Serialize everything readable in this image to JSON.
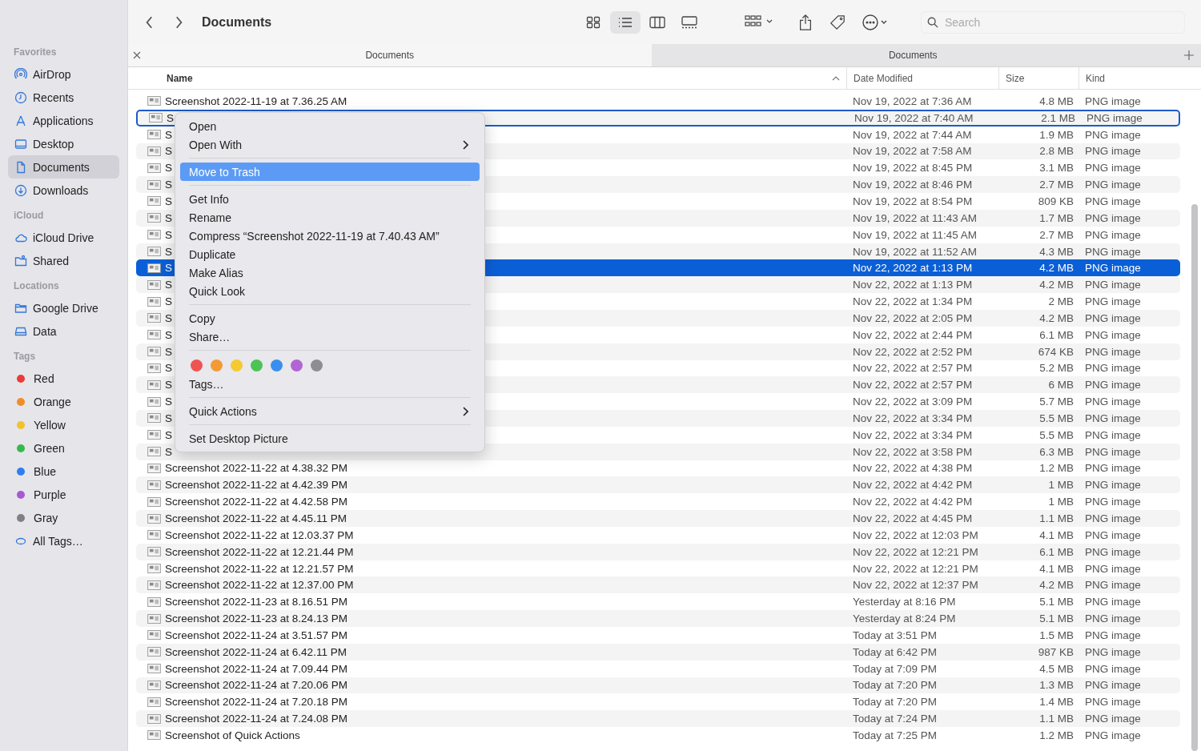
{
  "sidebar": {
    "sections": [
      {
        "title": "Favorites",
        "items": [
          {
            "label": "AirDrop",
            "kind": "airdrop",
            "selected": false
          },
          {
            "label": "Recents",
            "kind": "clock",
            "selected": false
          },
          {
            "label": "Applications",
            "kind": "apps",
            "selected": false
          },
          {
            "label": "Desktop",
            "kind": "desktop",
            "selected": false
          },
          {
            "label": "Documents",
            "kind": "doc",
            "selected": true
          },
          {
            "label": "Downloads",
            "kind": "download",
            "selected": false
          }
        ]
      },
      {
        "title": "iCloud",
        "items": [
          {
            "label": "iCloud Drive",
            "kind": "cloud",
            "selected": false
          },
          {
            "label": "Shared",
            "kind": "shared",
            "selected": false
          }
        ]
      },
      {
        "title": "Locations",
        "items": [
          {
            "label": "Google Drive",
            "kind": "folder",
            "selected": false
          },
          {
            "label": "Data",
            "kind": "disk",
            "selected": false
          }
        ]
      },
      {
        "title": "Tags",
        "items": [
          {
            "label": "Red",
            "kind": "tag",
            "color": "#ea3b36",
            "selected": false
          },
          {
            "label": "Orange",
            "kind": "tag",
            "color": "#f08d2a",
            "selected": false
          },
          {
            "label": "Yellow",
            "kind": "tag",
            "color": "#f2c22a",
            "selected": false
          },
          {
            "label": "Green",
            "kind": "tag",
            "color": "#34b94a",
            "selected": false
          },
          {
            "label": "Blue",
            "kind": "tag",
            "color": "#2d7ff0",
            "selected": false
          },
          {
            "label": "Purple",
            "kind": "tag",
            "color": "#a859d2",
            "selected": false
          },
          {
            "label": "Gray",
            "kind": "tag",
            "color": "#808085",
            "selected": false
          },
          {
            "label": "All Tags…",
            "kind": "alltags",
            "selected": false
          }
        ]
      }
    ]
  },
  "toolbar": {
    "title": "Documents",
    "views": [
      {
        "kind": "icons",
        "selected": false
      },
      {
        "kind": "list",
        "selected": true
      },
      {
        "kind": "columns",
        "selected": false
      },
      {
        "kind": "gallery",
        "selected": false
      }
    ],
    "search": {
      "placeholder": "Search"
    }
  },
  "tabs": [
    {
      "label": "Documents",
      "selected": true
    },
    {
      "label": "Documents",
      "selected": false
    }
  ],
  "columns": [
    {
      "label": "Name",
      "sorted": true
    },
    {
      "label": "Date Modified",
      "sorted": false
    },
    {
      "label": "Size",
      "sorted": false
    },
    {
      "label": "Kind",
      "sorted": false
    }
  ],
  "rows": [
    {
      "name": "Screenshot 2022-11-19 at 7.36.25 AM",
      "date": "Nov 19, 2022 at 7:36 AM",
      "size": "4.8 MB",
      "kind": "PNG image",
      "selected": false,
      "targeted": false
    },
    {
      "name": "S",
      "date": "Nov 19, 2022 at 7:40 AM",
      "size": "2.1 MB",
      "kind": "PNG image",
      "selected": false,
      "targeted": true
    },
    {
      "name": "S",
      "date": "Nov 19, 2022 at 7:44 AM",
      "size": "1.9 MB",
      "kind": "PNG image",
      "selected": false,
      "targeted": false
    },
    {
      "name": "S",
      "date": "Nov 19, 2022 at 7:58 AM",
      "size": "2.8 MB",
      "kind": "PNG image",
      "selected": false,
      "targeted": false
    },
    {
      "name": "S",
      "date": "Nov 19, 2022 at 8:45 PM",
      "size": "3.1 MB",
      "kind": "PNG image",
      "selected": false,
      "targeted": false
    },
    {
      "name": "S",
      "date": "Nov 19, 2022 at 8:46 PM",
      "size": "2.7 MB",
      "kind": "PNG image",
      "selected": false,
      "targeted": false
    },
    {
      "name": "S",
      "date": "Nov 19, 2022 at 8:54 PM",
      "size": "809 KB",
      "kind": "PNG image",
      "selected": false,
      "targeted": false
    },
    {
      "name": "S",
      "date": "Nov 19, 2022 at 11:43 AM",
      "size": "1.7 MB",
      "kind": "PNG image",
      "selected": false,
      "targeted": false
    },
    {
      "name": "S",
      "date": "Nov 19, 2022 at 11:45 AM",
      "size": "2.7 MB",
      "kind": "PNG image",
      "selected": false,
      "targeted": false
    },
    {
      "name": "S",
      "date": "Nov 19, 2022 at 11:52 AM",
      "size": "4.3 MB",
      "kind": "PNG image",
      "selected": false,
      "targeted": false
    },
    {
      "name": "S",
      "date": "Nov 22, 2022 at 1:13 PM",
      "size": "4.2 MB",
      "kind": "PNG image",
      "selected": true,
      "targeted": false
    },
    {
      "name": "S",
      "date": "Nov 22, 2022 at 1:13 PM",
      "size": "4.2 MB",
      "kind": "PNG image",
      "selected": false,
      "targeted": false
    },
    {
      "name": "S",
      "date": "Nov 22, 2022 at 1:34 PM",
      "size": "2 MB",
      "kind": "PNG image",
      "selected": false,
      "targeted": false
    },
    {
      "name": "S",
      "date": "Nov 22, 2022 at 2:05 PM",
      "size": "4.2 MB",
      "kind": "PNG image",
      "selected": false,
      "targeted": false
    },
    {
      "name": "S",
      "date": "Nov 22, 2022 at 2:44 PM",
      "size": "6.1 MB",
      "kind": "PNG image",
      "selected": false,
      "targeted": false
    },
    {
      "name": "S",
      "date": "Nov 22, 2022 at 2:52 PM",
      "size": "674 KB",
      "kind": "PNG image",
      "selected": false,
      "targeted": false
    },
    {
      "name": "S",
      "date": "Nov 22, 2022 at 2:57 PM",
      "size": "5.2 MB",
      "kind": "PNG image",
      "selected": false,
      "targeted": false
    },
    {
      "name": "S",
      "date": "Nov 22, 2022 at 2:57 PM",
      "size": "6 MB",
      "kind": "PNG image",
      "selected": false,
      "targeted": false
    },
    {
      "name": "S",
      "date": "Nov 22, 2022 at 3:09 PM",
      "size": "5.7 MB",
      "kind": "PNG image",
      "selected": false,
      "targeted": false
    },
    {
      "name": "S",
      "date": "Nov 22, 2022 at 3:34 PM",
      "size": "5.5 MB",
      "kind": "PNG image",
      "selected": false,
      "targeted": false
    },
    {
      "name": "S",
      "date": "Nov 22, 2022 at 3:34 PM",
      "size": "5.5 MB",
      "kind": "PNG image",
      "selected": false,
      "targeted": false
    },
    {
      "name": "S",
      "date": "Nov 22, 2022 at 3:58 PM",
      "size": "6.3 MB",
      "kind": "PNG image",
      "selected": false,
      "targeted": false
    },
    {
      "name": "Screenshot 2022-11-22 at 4.38.32 PM",
      "date": "Nov 22, 2022 at 4:38 PM",
      "size": "1.2 MB",
      "kind": "PNG image",
      "selected": false,
      "targeted": false
    },
    {
      "name": "Screenshot 2022-11-22 at 4.42.39 PM",
      "date": "Nov 22, 2022 at 4:42 PM",
      "size": "1 MB",
      "kind": "PNG image",
      "selected": false,
      "targeted": false
    },
    {
      "name": "Screenshot 2022-11-22 at 4.42.58 PM",
      "date": "Nov 22, 2022 at 4:42 PM",
      "size": "1 MB",
      "kind": "PNG image",
      "selected": false,
      "targeted": false
    },
    {
      "name": "Screenshot 2022-11-22 at 4.45.11 PM",
      "date": "Nov 22, 2022 at 4:45 PM",
      "size": "1.1 MB",
      "kind": "PNG image",
      "selected": false,
      "targeted": false
    },
    {
      "name": "Screenshot 2022-11-22 at 12.03.37 PM",
      "date": "Nov 22, 2022 at 12:03 PM",
      "size": "4.1 MB",
      "kind": "PNG image",
      "selected": false,
      "targeted": false
    },
    {
      "name": "Screenshot 2022-11-22 at 12.21.44 PM",
      "date": "Nov 22, 2022 at 12:21 PM",
      "size": "6.1 MB",
      "kind": "PNG image",
      "selected": false,
      "targeted": false
    },
    {
      "name": "Screenshot 2022-11-22 at 12.21.57 PM",
      "date": "Nov 22, 2022 at 12:21 PM",
      "size": "4.1 MB",
      "kind": "PNG image",
      "selected": false,
      "targeted": false
    },
    {
      "name": "Screenshot 2022-11-22 at 12.37.00 PM",
      "date": "Nov 22, 2022 at 12:37 PM",
      "size": "4.2 MB",
      "kind": "PNG image",
      "selected": false,
      "targeted": false
    },
    {
      "name": "Screenshot 2022-11-23 at 8.16.51 PM",
      "date": "Yesterday at 8:16 PM",
      "size": "5.1 MB",
      "kind": "PNG image",
      "selected": false,
      "targeted": false
    },
    {
      "name": "Screenshot 2022-11-23 at 8.24.13 PM",
      "date": "Yesterday at 8:24 PM",
      "size": "5.1 MB",
      "kind": "PNG image",
      "selected": false,
      "targeted": false
    },
    {
      "name": "Screenshot 2022-11-24 at 3.51.57 PM",
      "date": "Today at 3:51 PM",
      "size": "1.5 MB",
      "kind": "PNG image",
      "selected": false,
      "targeted": false
    },
    {
      "name": "Screenshot 2022-11-24 at 6.42.11 PM",
      "date": "Today at 6:42 PM",
      "size": "987 KB",
      "kind": "PNG image",
      "selected": false,
      "targeted": false
    },
    {
      "name": "Screenshot 2022-11-24 at 7.09.44 PM",
      "date": "Today at 7:09 PM",
      "size": "4.5 MB",
      "kind": "PNG image",
      "selected": false,
      "targeted": false
    },
    {
      "name": "Screenshot 2022-11-24 at 7.20.06 PM",
      "date": "Today at 7:20 PM",
      "size": "1.3 MB",
      "kind": "PNG image",
      "selected": false,
      "targeted": false
    },
    {
      "name": "Screenshot 2022-11-24 at 7.20.18 PM",
      "date": "Today at 7:20 PM",
      "size": "1.4 MB",
      "kind": "PNG image",
      "selected": false,
      "targeted": false
    },
    {
      "name": "Screenshot 2022-11-24 at 7.24.08 PM",
      "date": "Today at 7:24 PM",
      "size": "1.1 MB",
      "kind": "PNG image",
      "selected": false,
      "targeted": false
    },
    {
      "name": "Screenshot of Quick Actions",
      "date": "Today at 7:25 PM",
      "size": "1.2 MB",
      "kind": "PNG image",
      "selected": false,
      "targeted": false
    }
  ],
  "menu": {
    "items": [
      {
        "kind": "item",
        "label": "Open",
        "submenu": false,
        "highlighted": false
      },
      {
        "kind": "item",
        "label": "Open With",
        "submenu": true,
        "highlighted": false
      },
      {
        "kind": "separator"
      },
      {
        "kind": "item",
        "label": "Move to Trash",
        "submenu": false,
        "highlighted": true
      },
      {
        "kind": "separator"
      },
      {
        "kind": "item",
        "label": "Get Info",
        "submenu": false,
        "highlighted": false
      },
      {
        "kind": "item",
        "label": "Rename",
        "submenu": false,
        "highlighted": false
      },
      {
        "kind": "item",
        "label": "Compress “Screenshot 2022-11-19 at 7.40.43 AM”",
        "submenu": false,
        "highlighted": false
      },
      {
        "kind": "item",
        "label": "Duplicate",
        "submenu": false,
        "highlighted": false
      },
      {
        "kind": "item",
        "label": "Make Alias",
        "submenu": false,
        "highlighted": false
      },
      {
        "kind": "item",
        "label": "Quick Look",
        "submenu": false,
        "highlighted": false
      },
      {
        "kind": "separator"
      },
      {
        "kind": "item",
        "label": "Copy",
        "submenu": false,
        "highlighted": false
      },
      {
        "kind": "item",
        "label": "Share…",
        "submenu": false,
        "highlighted": false
      },
      {
        "kind": "separator"
      },
      {
        "kind": "colors",
        "colors": [
          {
            "color": "#ee5452"
          },
          {
            "color": "#f39a34"
          },
          {
            "color": "#f5c930"
          },
          {
            "color": "#4cc355"
          },
          {
            "color": "#3a8ef0"
          },
          {
            "color": "#b264d5"
          },
          {
            "color": "#8e8e92"
          }
        ]
      },
      {
        "kind": "item",
        "label": "Tags…",
        "submenu": false,
        "highlighted": false
      },
      {
        "kind": "separator"
      },
      {
        "kind": "item",
        "label": "Quick Actions",
        "submenu": true,
        "highlighted": false
      },
      {
        "kind": "separator"
      },
      {
        "kind": "item",
        "label": "Set Desktop Picture",
        "submenu": false,
        "highlighted": false
      }
    ]
  }
}
